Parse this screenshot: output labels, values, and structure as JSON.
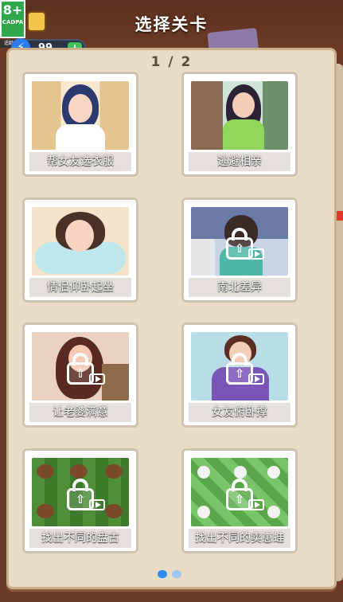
{
  "header": {
    "title": "选择关卡",
    "age_rating": "8+",
    "age_org": "CADPA",
    "age_tip": "适龄提示",
    "energy_value": "99",
    "energy_plus": "+"
  },
  "pager": {
    "text": "1 / 2",
    "current_page": 1,
    "total_pages": 2
  },
  "levels": [
    {
      "label": "帮女友选衣服",
      "locked": false,
      "icon": ""
    },
    {
      "label": "逃避相亲",
      "locked": false,
      "icon": ""
    },
    {
      "label": "情侣仰卧起坐",
      "locked": false,
      "icon": ""
    },
    {
      "label": "南北差异",
      "locked": true,
      "icon": "ad-lock"
    },
    {
      "label": "让老婆满意",
      "locked": true,
      "icon": "ad-lock"
    },
    {
      "label": "女友俯卧撑",
      "locked": true,
      "icon": "ad-lock"
    },
    {
      "label": "找出不同的盘古",
      "locked": true,
      "icon": "ad-lock"
    },
    {
      "label": "找出不同的卖崽蛙",
      "locked": true,
      "icon": "ad-lock"
    }
  ],
  "colors": {
    "background": "#6b3a26",
    "book": "#e9dcc6",
    "dot_active": "#2f8df0"
  },
  "lock_arrow": "⇧"
}
